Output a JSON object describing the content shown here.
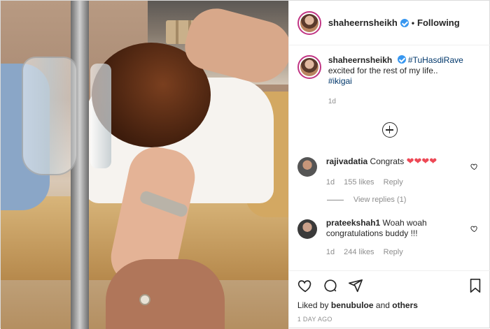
{
  "post": {
    "author": "shaheernsheikh",
    "follow_status": "Following",
    "separator": "•"
  },
  "caption": {
    "username": "shaheernsheikh",
    "hashtag_inline": "#TuHasdiRave",
    "text": "excited for the rest of my life..",
    "hashtag_bottom": "#ikigai",
    "time": "1d"
  },
  "comments": [
    {
      "username": "rajivadatia",
      "text": "Congrats",
      "emoji": "❤❤❤❤",
      "time": "1d",
      "likes": "155 likes",
      "reply": "Reply",
      "view_replies": "View replies (1)"
    },
    {
      "username": "prateekshah1",
      "text": "Woah woah congratulations buddy !!!",
      "time": "1d",
      "likes": "244 likes",
      "reply": "Reply"
    }
  ],
  "likes": {
    "prefix": "Liked by",
    "user": "benubuloe",
    "conjunction": "and",
    "others": "others"
  },
  "date": "1 DAY AGO",
  "icons": {
    "verified": "verified-badge-icon",
    "add": "add-comment-plus-icon",
    "like": "heart-icon",
    "comment": "comment-bubble-icon",
    "share": "paper-plane-icon",
    "save": "bookmark-icon"
  },
  "colors": {
    "verified": "#3897f0",
    "hashtag": "#00376b",
    "heart_red": "#ed4956",
    "muted": "#8e8e8e"
  }
}
